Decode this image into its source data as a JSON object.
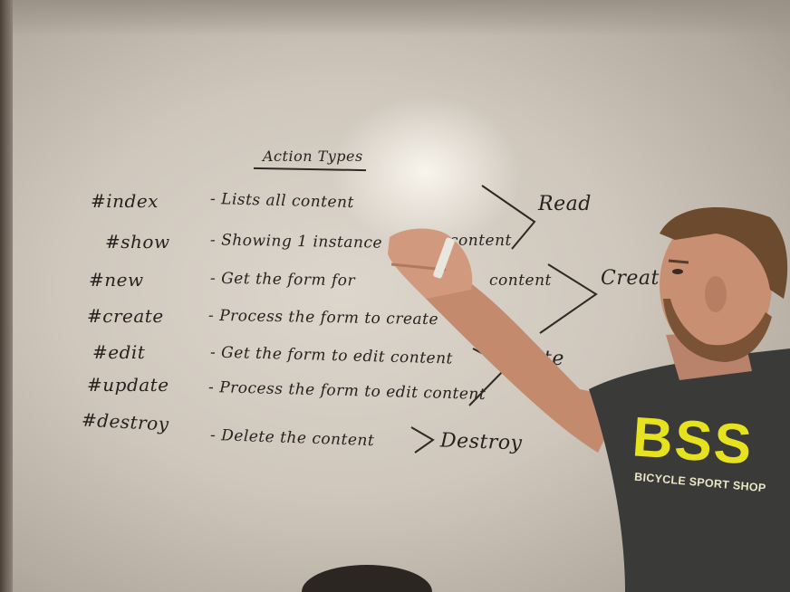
{
  "board": {
    "title": "Action Types",
    "rows": [
      {
        "action": "#index",
        "description": "- Lists all content"
      },
      {
        "action": "#show",
        "description": "- Showing 1 instance"
      },
      {
        "action": "#new",
        "description": "- Get the form for"
      },
      {
        "action": "#create",
        "description": "- Process the form to create"
      },
      {
        "action": "#edit",
        "description": "- Get the form to edit content"
      },
      {
        "action": "#update",
        "description": "- Process the form to edit content"
      },
      {
        "action": "#destroy",
        "description": "- Delete the content"
      }
    ],
    "fragments": {
      "show_tail": "content",
      "new_tail": "content",
      "edit_tail": "te"
    },
    "categories": {
      "read": "Read",
      "create": "Create",
      "destroy": "Destroy"
    }
  },
  "shirt": {
    "logo": "BSS",
    "tagline": "BICYCLE SPORT SHOP"
  },
  "colors": {
    "whiteboard": "#d9d1c6",
    "ink": "#26221e",
    "shirt": "#3a3a38",
    "shirt_print": "#e6e21f",
    "skin": "#c98f73",
    "hair": "#6b4a2d"
  }
}
